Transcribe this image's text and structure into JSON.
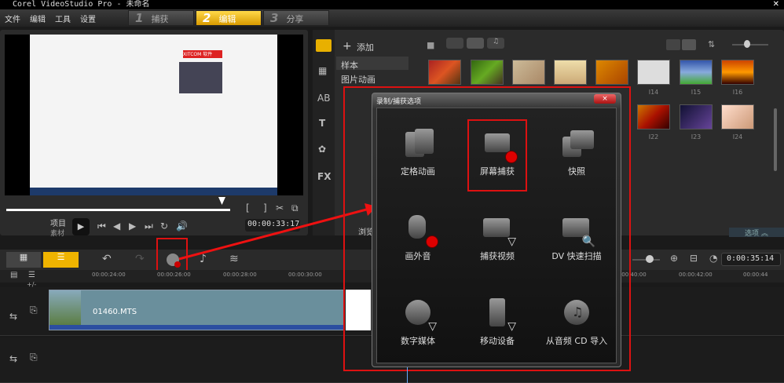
{
  "window": {
    "title": "Corel VideoStudio Pro - 未命名"
  },
  "menu": [
    "文件",
    "编辑",
    "工具",
    "设置"
  ],
  "steps": [
    {
      "num": "1",
      "label": "捕获"
    },
    {
      "num": "2",
      "label": "编辑"
    },
    {
      "num": "3",
      "label": "分享"
    }
  ],
  "preview": {
    "project_label": "项目",
    "clip_label": "素材",
    "timecode": "00:00:33:17",
    "screen_logo": "XITCOM 软件"
  },
  "library": {
    "add_label": "添加",
    "folders": [
      "样本",
      "图片动画"
    ],
    "browse_label": "浏览",
    "options_label": "选项",
    "thumb_labels": [
      "I14",
      "I15",
      "I16",
      "I22",
      "I23",
      "I24"
    ]
  },
  "timeline": {
    "timecode": "0:00:35:14",
    "ticks": [
      "00:00:24:00",
      "00:00:26:00",
      "00:00:28:00",
      "00:00:30:00",
      "00:00:40:00",
      "00:00:42:00",
      "00:00:44"
    ],
    "clip_name": "01460.MTS",
    "zoom_label": "+/-"
  },
  "dialog": {
    "title": "录制/捕获选项",
    "close": "×",
    "options": [
      "定格动画",
      "屏幕捕获",
      "快照",
      "画外音",
      "捕获视频",
      "DV 快速扫描",
      "数字媒体",
      "移动设备",
      "从音频 CD 导入"
    ]
  },
  "colors": {
    "accent": "#f0b400",
    "highlight": "#dd1111"
  }
}
